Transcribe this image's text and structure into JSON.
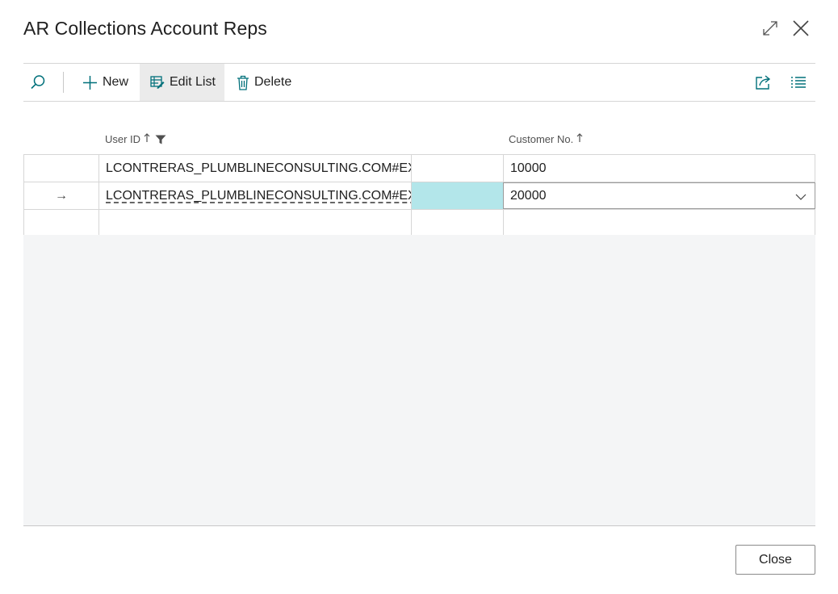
{
  "window": {
    "title": "AR Collections Account Reps",
    "expand_icon": "expand-icon",
    "close_icon": "close-icon"
  },
  "toolbar": {
    "search_icon": "search-icon",
    "new_label": "New",
    "edit_list_label": "Edit List",
    "delete_label": "Delete",
    "share_icon": "share-icon",
    "list_view_icon": "list-view-icon"
  },
  "columns": {
    "user_id": "User ID",
    "customer_no": "Customer No."
  },
  "rows": [
    {
      "user_id": "LCONTRERAS_PLUMBLINECONSULTING.COM#EXT#",
      "customer_no": "10000"
    },
    {
      "user_id": "LCONTRERAS_PLUMBLINECONSULTING.COM#EXT#",
      "customer_no": "20000"
    }
  ],
  "row_indicator": "→",
  "footer": {
    "close_label": "Close"
  },
  "colors": {
    "accent": "#00707a",
    "highlight_cell": "#b3e6ea"
  }
}
